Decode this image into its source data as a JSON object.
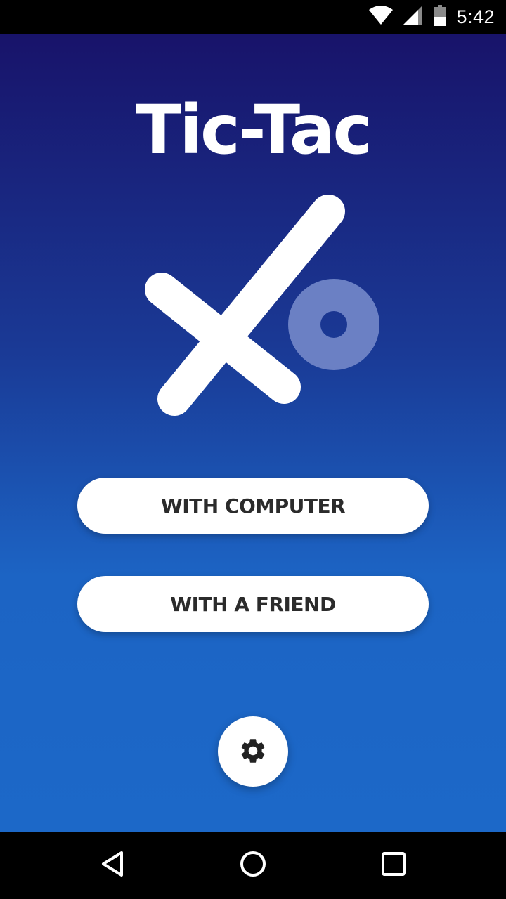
{
  "status_bar": {
    "time": "5:42",
    "icons": [
      "wifi-icon",
      "cell-signal-icon",
      "battery-icon"
    ]
  },
  "app": {
    "title": "Tic-Tac",
    "logo": "x-and-o-logo",
    "colors": {
      "gradient_top": "#18136a",
      "gradient_bottom": "#1c68c8",
      "button_bg": "#ffffff",
      "button_text": "#2b2b2b",
      "o_mark": "#6b80c4"
    }
  },
  "menu": {
    "with_computer": "WITH COMPUTER",
    "with_friend": "WITH A FRIEND",
    "settings_icon": "gear-icon"
  },
  "nav_bar": {
    "icons": [
      "back-icon",
      "home-icon",
      "recents-icon"
    ]
  }
}
